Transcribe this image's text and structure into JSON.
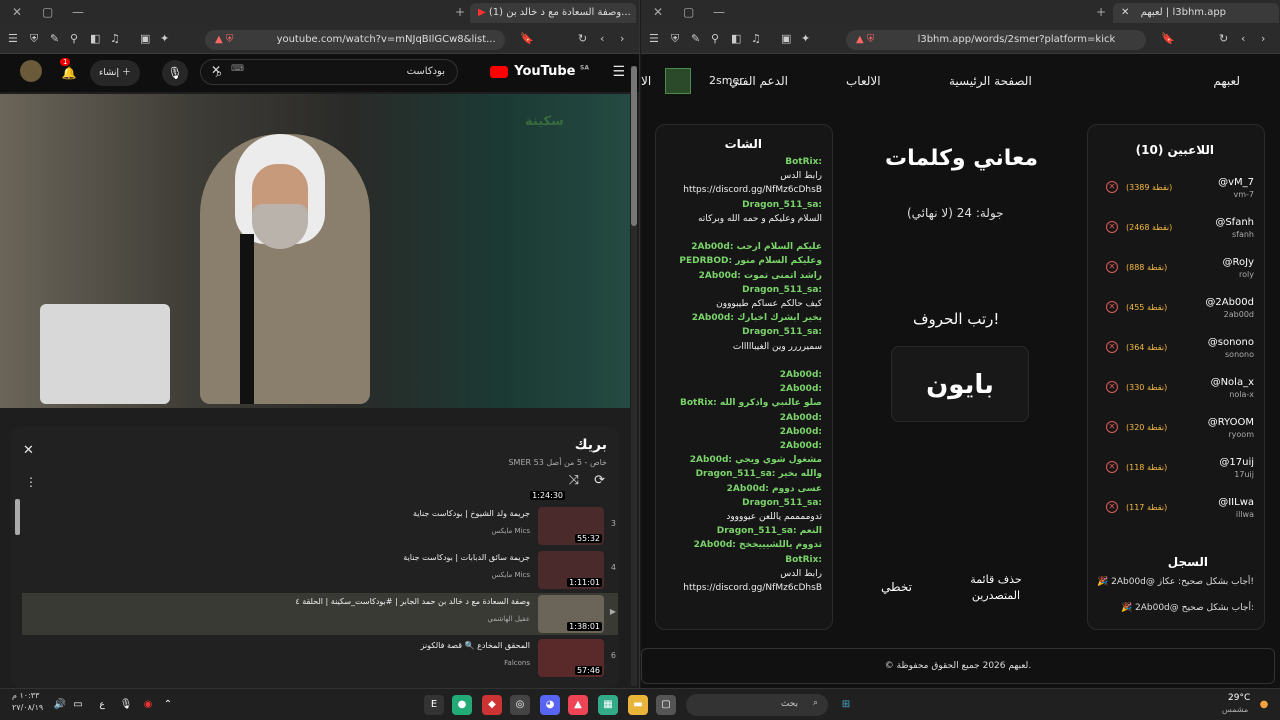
{
  "left": {
    "tab_title": "(1) وصفة السعادة مع د خالد بن...",
    "url": "youtube.com/watch?v=mNJqBIlGCw8&list...",
    "yt": {
      "logo": "YouTube",
      "country": "SA",
      "search": "بودكاست",
      "create": "إنشاء",
      "notif": "1"
    },
    "video_brand": "سكينة",
    "playlist": {
      "title": "بريك",
      "sub": "SMER خاص - 5 من أصل 53",
      "top_dur": "1:24:30",
      "items": [
        {
          "n": "3",
          "title": "جريمة ولد الشيوخ | بودكاست جناية",
          "channel": "مايكس Mics",
          "dur": "55:32"
        },
        {
          "n": "4",
          "title": "جريمة سائق الدبابات | بودكاست جناية",
          "channel": "مايكس Mics",
          "dur": "1:11:01"
        },
        {
          "n": "▶",
          "title": "وصفة السعادة مع د خالد بن حمد الجابر | #بودكاست_سكينة | الحلقة ٤",
          "channel": "عقيل الهاشمي",
          "dur": "1:38:01"
        },
        {
          "n": "6",
          "title": "المحقق المخادع 🔍 قصة فالكونز",
          "channel": "Falcons",
          "dur": "57:46"
        }
      ]
    }
  },
  "right": {
    "tab_title": "لعبهم | l3bhm.app",
    "url": "l3bhm.app/words/2smer?platform=kick",
    "nav": {
      "logo": "لعبهم",
      "home": "الصفحة الرئيسية",
      "games": "الالعاب",
      "support": "الدعم الفني",
      "user": "2smer",
      "last": "الا"
    },
    "players_title": "اللاعبين (10)",
    "players": [
      {
        "name": "@vM_7",
        "user": "vm-7",
        "pts": "(3389 نقطة)"
      },
      {
        "name": "@Sfanh",
        "user": "sfanh",
        "pts": "(2468 نقطة)"
      },
      {
        "name": "@RoJy",
        "user": "roly",
        "pts": "(888 نقطة)"
      },
      {
        "name": "@2Ab00d",
        "user": "2ab00d",
        "pts": "(455 نقطة)"
      },
      {
        "name": "@sonono",
        "user": "sonono",
        "pts": "(364 نقطة)"
      },
      {
        "name": "@Nola_x",
        "user": "nola-x",
        "pts": "(330 نقطة)"
      },
      {
        "name": "@RYOOM",
        "user": "ryoom",
        "pts": "(320 نقطة)"
      },
      {
        "name": "@17uij",
        "user": "17uij",
        "pts": "(118 نقطة)"
      },
      {
        "name": "@IILwa",
        "user": "illwa",
        "pts": "(117 نقطة)"
      }
    ],
    "log_title": "السجل",
    "log": [
      "🎉 2Ab00d@ أجاب بشكل صحيح: عكاز!",
      "🎉 2Ab00d@ أجاب بشكل صحيح:"
    ],
    "game": {
      "title": "معاني وكلمات",
      "round": "جولة: 24 (لا نهائي)",
      "prompt": "رتب الحروف!",
      "word": "بايون",
      "skip": "تخطي",
      "delete": "حذف قائمة المتصدرين"
    },
    "chat_title": "الشات",
    "chat": [
      "BotRix:",
      "رابط الدس",
      "https://discord.gg/NfMz6cDhsB",
      "Dragon_511_sa:",
      "السلام وعليكم و حمه الله وبركاته",
      "",
      "2Ab00d: عليكم السلام ارحب",
      "PEDRBOD: وعليكم السلام منور",
      "2Ab00d: راشد اتمنى تموت",
      "Dragon_511_sa:",
      "كيف حالكم عساكم طيبووون",
      "2Ab00d: بخير ابشرك اخبارك",
      "Dragon_511_sa:",
      "سميرررر وين الغيبااااات",
      "",
      "2Ab00d:",
      "2Ab00d:",
      "BotRix: صلو عالنبي واذكرو الله",
      "2Ab00d:",
      "2Ab00d:",
      "2Ab00d:",
      "2Ab00d: مشغول شوي ويجي",
      "Dragon_511_sa: والله بخير",
      "2Ab00d: عسى دووم",
      "Dragon_511_sa:",
      "تدوممممم ياللعن عيوووود",
      "Dragon_511_sa: النعم",
      "2Ab00d: تدووم ياللشيييخخخ",
      "BotRix:",
      "رابط الدس",
      "https://discord.gg/NfMz6cDhsB"
    ],
    "footer": "© لعبهم 2026 جميع الحقوق محفوظة."
  },
  "taskbar": {
    "time": "١٠:٣٣ م",
    "date": "٢٧/٠٨/١٩",
    "weather": "29°C",
    "weather_sub": "مشمس",
    "search": "بحث",
    "lang": "ع"
  }
}
